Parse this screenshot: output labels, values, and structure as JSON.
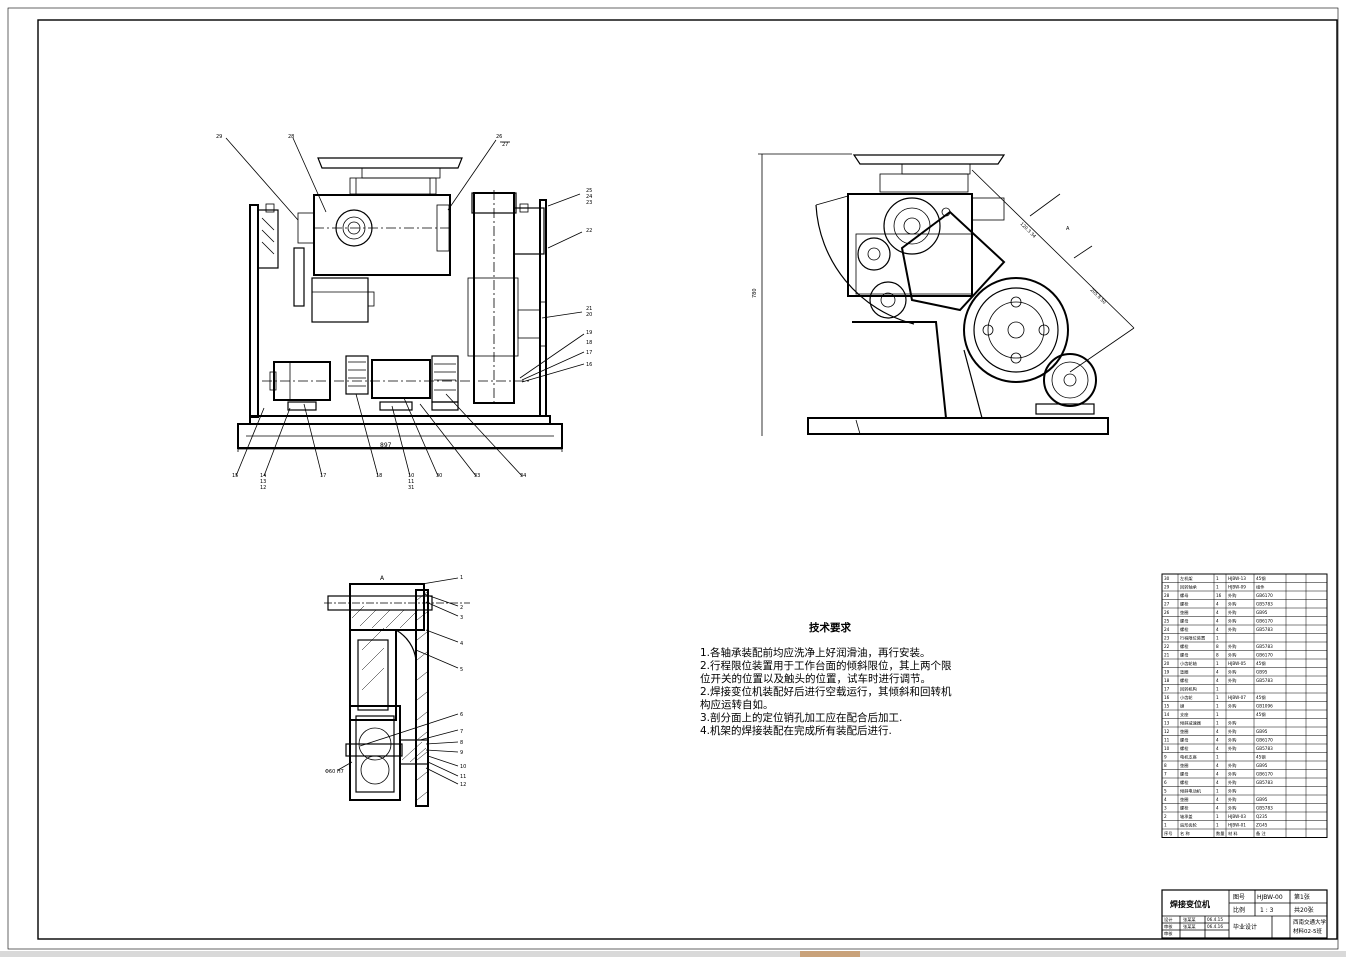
{
  "drawing": {
    "name": "焊接变位机",
    "drawing_no_label": "图号",
    "drawing_no": "HJBW-00",
    "sheet_label": "第1张",
    "scale_label": "比例",
    "scale": "1 : 3",
    "total_label": "共20张",
    "project": "毕业设计",
    "school": "西南交通大学",
    "class": "材料02-5班",
    "roles": [
      {
        "role": "设计",
        "name": "张某某",
        "date": "06.4.15"
      },
      {
        "role": "审核",
        "name": "张某某",
        "date": "06.4.16"
      },
      {
        "role": "审核",
        "name": "",
        "date": ""
      }
    ]
  },
  "technical_requirements": {
    "title": "技术要求",
    "lines": [
      "1.各轴承装配前均应洗净上好润滑油，再行安装。",
      "2.行程限位装置用于工作台面的倾斜限位，其上两个限",
      "位开关的位置以及触头的位置，试车时进行调节。",
      "2.焊接变位机装配好后进行空载运行，其倾斜和回转机",
      "构应运转自如。",
      "3.剖分面上的定位销孔加工应在配合后加工.",
      "4.机架的焊接装配在完成所有装配后进行."
    ]
  },
  "front_view": {
    "width_dim": "897",
    "leaders_top": [
      "29",
      "28",
      "27",
      "26"
    ],
    "leaders_right": [
      "25",
      "24",
      "23",
      "22",
      "21",
      "20",
      "19"
    ],
    "leaders_bottom": [
      "15",
      "16",
      "13",
      "17",
      "18",
      "10",
      "11",
      "12",
      "14",
      "30"
    ]
  },
  "side_view": {
    "height_dim": "780",
    "labels": [
      "A"
    ]
  },
  "section_view": {
    "title": "A",
    "callouts": [
      "1",
      "2",
      "3",
      "4",
      "5",
      "6",
      "7",
      "8",
      "9",
      "10",
      "11",
      "12"
    ],
    "dim": "Φ60 H7"
  },
  "bom": {
    "header": [
      "序号",
      "名 称",
      "数量",
      "材 料",
      "备 注"
    ],
    "rows": [
      [
        "30",
        "左机架",
        "1",
        "HJBW-13",
        "45钢"
      ],
      [
        "29",
        "回转轴承",
        "1",
        "HJBW-09",
        "组件"
      ],
      [
        "28",
        "螺母",
        "16",
        "外购",
        "GB6170"
      ],
      [
        "27",
        "螺栓",
        "4",
        "外购",
        "GB5783"
      ],
      [
        "26",
        "垫圈",
        "4",
        "外购",
        "GB95"
      ],
      [
        "25",
        "螺母",
        "4",
        "外购",
        "GB6170"
      ],
      [
        "24",
        "螺栓",
        "4",
        "外购",
        "GB5783"
      ],
      [
        "23",
        "行程限位装置",
        "1",
        "",
        ""
      ],
      [
        "22",
        "螺栓",
        "8",
        "外购",
        "GB5783"
      ],
      [
        "21",
        "螺母",
        "8",
        "外购",
        "GB6170"
      ],
      [
        "20",
        "小齿轮轴",
        "1",
        "HJBW-05",
        "45钢"
      ],
      [
        "19",
        "垫圈",
        "4",
        "外购",
        "GB95"
      ],
      [
        "18",
        "螺栓",
        "4",
        "外购",
        "GB5783"
      ],
      [
        "17",
        "回转机构",
        "1",
        "",
        ""
      ],
      [
        "16",
        "小齿轮",
        "1",
        "HJBW-07",
        "45钢"
      ],
      [
        "15",
        "键",
        "1",
        "外购",
        "GB1096"
      ],
      [
        "14",
        "支座",
        "1",
        "",
        "45钢"
      ],
      [
        "13",
        "倾斜减速器",
        "1",
        "外购",
        ""
      ],
      [
        "12",
        "垫圈",
        "4",
        "外购",
        "GB95"
      ],
      [
        "11",
        "螺母",
        "4",
        "外购",
        "GB6170"
      ],
      [
        "10",
        "螺栓",
        "4",
        "外购",
        "GB5783"
      ],
      [
        "9",
        "电机支座",
        "1",
        "",
        "45钢"
      ],
      [
        "8",
        "垫圈",
        "4",
        "外购",
        "GB95"
      ],
      [
        "7",
        "螺母",
        "4",
        "外购",
        "GB6170"
      ],
      [
        "6",
        "螺栓",
        "4",
        "外购",
        "GB5783"
      ],
      [
        "5",
        "倾斜电动机",
        "1",
        "外购",
        ""
      ],
      [
        "4",
        "垫圈",
        "4",
        "外购",
        "GB95"
      ],
      [
        "3",
        "螺栓",
        "4",
        "外购",
        "GB5783"
      ],
      [
        "2",
        "轴承盖",
        "1",
        "HJBW-03",
        "Q235"
      ],
      [
        "1",
        "扇形齿轮",
        "1",
        "HJBW-01",
        "ZG45"
      ]
    ]
  }
}
